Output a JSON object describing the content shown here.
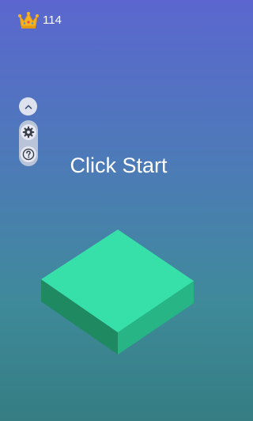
{
  "hud": {
    "best_score": "114",
    "best_icon": "crown-icon"
  },
  "menu": {
    "items": [
      {
        "name": "collapse",
        "icon": "chevron-up-icon"
      },
      {
        "name": "settings",
        "icon": "gear-icon"
      },
      {
        "name": "help",
        "icon": "question-icon"
      }
    ]
  },
  "game": {
    "prompt": "Click Start",
    "tile_colors": {
      "top": "#36e0a8",
      "left": "#1f8a62",
      "right": "#28b585"
    }
  },
  "colors": {
    "crown": "#f5b324",
    "background_top": "#5b67cf",
    "background_bottom": "#357d83"
  }
}
